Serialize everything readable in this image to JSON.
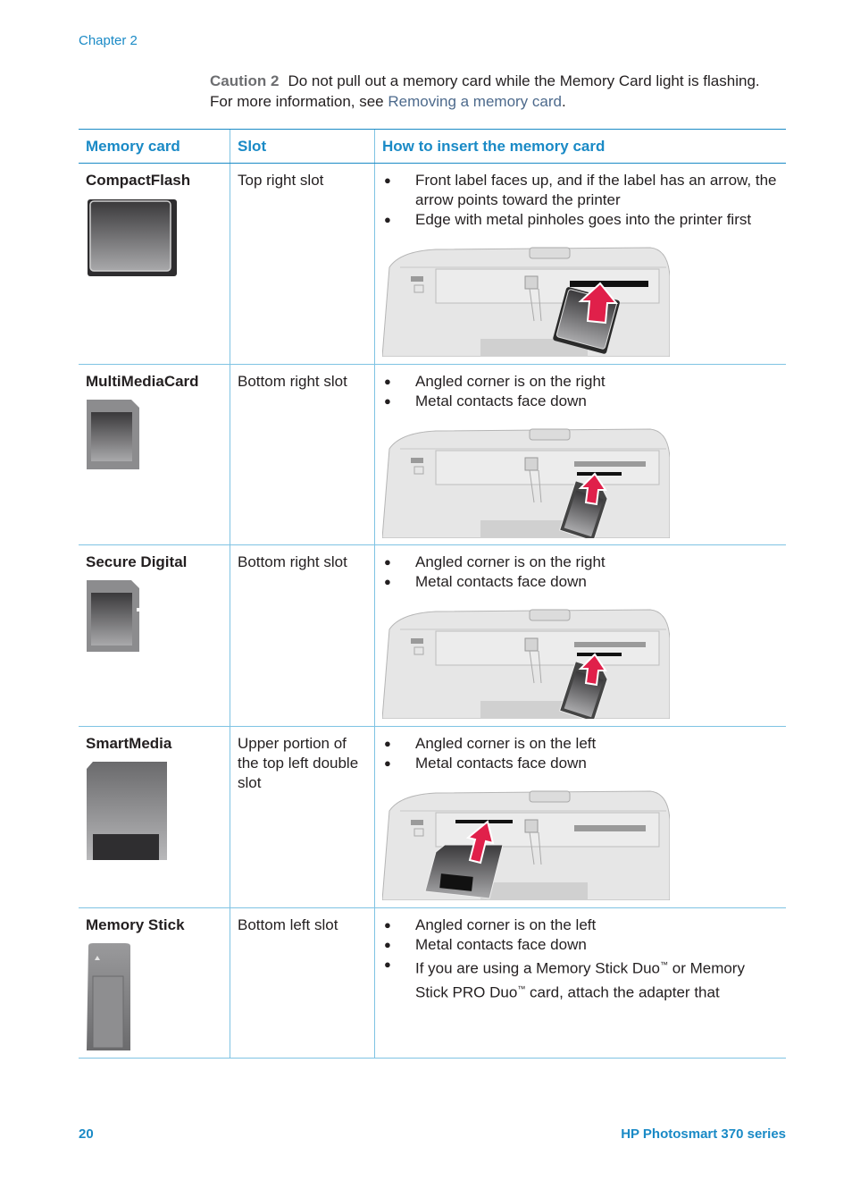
{
  "header": {
    "chapter": "Chapter 2"
  },
  "caution": {
    "label": "Caution 2",
    "text": "Do not pull out a memory card while the Memory Card light is flashing. For more information, see ",
    "link": "Removing a memory card",
    "end": "."
  },
  "table": {
    "headers": [
      "Memory card",
      "Slot",
      "How to insert the memory card"
    ],
    "rows": [
      {
        "card": "CompactFlash",
        "slot": "Top right slot",
        "image_icon": "compactflash-card-icon",
        "steps": [
          "Front label faces up, and if the label has an arrow, the arrow points toward the printer",
          "Edge with metal pinholes goes into the printer first"
        ]
      },
      {
        "card": "MultiMediaCard",
        "slot": "Bottom right slot",
        "image_icon": "multimediacard-icon",
        "steps": [
          "Angled corner is on the right",
          "Metal contacts face down"
        ]
      },
      {
        "card": "Secure Digital",
        "slot": "Bottom right slot",
        "image_icon": "secure-digital-card-icon",
        "steps": [
          "Angled corner is on the right",
          "Metal contacts face down"
        ]
      },
      {
        "card": "SmartMedia",
        "slot": "Upper portion of the top left double slot",
        "image_icon": "smartmedia-card-icon",
        "steps": [
          "Angled corner is on the left",
          "Metal contacts face down"
        ]
      },
      {
        "card": "Memory Stick",
        "slot": "Bottom left slot",
        "image_icon": "memory-stick-icon",
        "steps": [
          "Angled corner is on the left",
          "Metal contacts face down"
        ],
        "step3_a": "If you are using a Memory Stick Duo",
        "step3_b": " or Memory Stick PRO Duo",
        "step3_c": " card, attach the adapter that",
        "tm": "™"
      }
    ]
  },
  "footer": {
    "page": "20",
    "title": "HP Photosmart 370 series"
  },
  "colors": {
    "accent": "#1a8ac6",
    "arrow": "#e0204a"
  }
}
